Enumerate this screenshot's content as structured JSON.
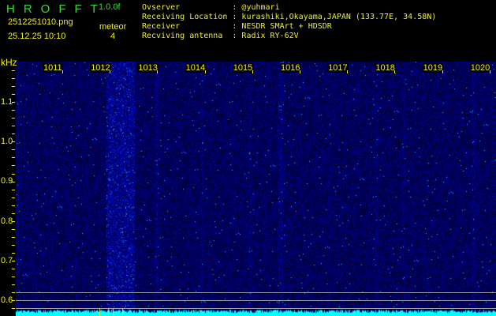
{
  "header": {
    "logo": "HROFFT",
    "version": "1.0.0f",
    "filename": "2512251010.png",
    "datetime": "25.12.25 10:10",
    "mode_label": "meteor",
    "count": "4"
  },
  "info": [
    {
      "label": "Ovserver           ",
      "value": ": @yuhmari"
    },
    {
      "label": "Receiving Location ",
      "value": ": kurashiki,Okayama,JAPAN (133.77E, 34.58N)"
    },
    {
      "label": "Receiver           ",
      "value": ": NESDR SMArt + HDSDR"
    },
    {
      "label": "Recviving antenna  ",
      "value": ": Radix RY-62V"
    }
  ],
  "axis": {
    "y_unit": "kHz",
    "freq_labels": [
      "1011",
      "1012",
      "1013",
      "1014",
      "1015",
      "1016",
      "1017",
      "1018",
      "1019",
      "1020"
    ],
    "khz_labels": [
      "1.1",
      "1.0",
      "0.9",
      "0.8",
      "0.7",
      "0.6"
    ]
  },
  "colors": {
    "logo": "#2de02d",
    "text": "#f0f020",
    "spectrum": "#00ffff",
    "background": "#000000"
  }
}
